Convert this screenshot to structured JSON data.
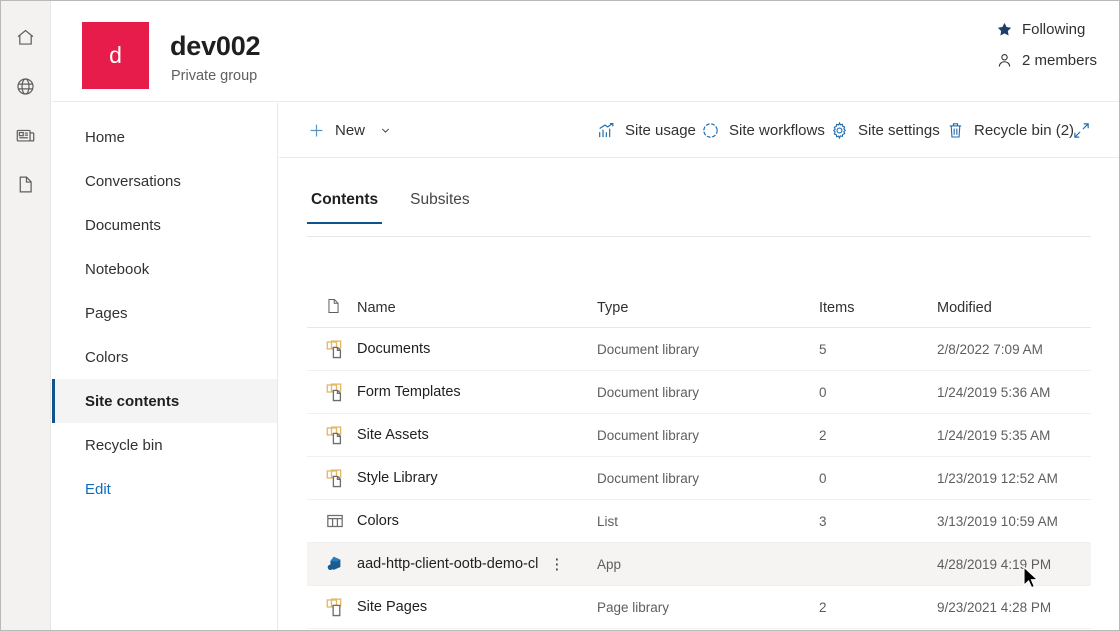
{
  "rail": {
    "items": [
      {
        "name": "home-icon",
        "label": "Home"
      },
      {
        "name": "globe-icon",
        "label": "My sites"
      },
      {
        "name": "news-icon",
        "label": "News"
      },
      {
        "name": "page-icon",
        "label": "Pages"
      }
    ]
  },
  "header": {
    "logo_letter": "d",
    "logo_color": "#e81c4a",
    "title": "dev002",
    "subtitle": "Private group",
    "following_label": "Following",
    "following_icon": "star-filled-icon",
    "members_label": "2 members",
    "members_icon": "person-icon"
  },
  "leftnav": {
    "items": [
      {
        "label": "Home",
        "selected": false,
        "link": false
      },
      {
        "label": "Conversations",
        "selected": false,
        "link": false
      },
      {
        "label": "Documents",
        "selected": false,
        "link": false
      },
      {
        "label": "Notebook",
        "selected": false,
        "link": false
      },
      {
        "label": "Pages",
        "selected": false,
        "link": false
      },
      {
        "label": "Colors",
        "selected": false,
        "link": false
      },
      {
        "label": "Site contents",
        "selected": true,
        "link": false
      },
      {
        "label": "Recycle bin",
        "selected": false,
        "link": false
      },
      {
        "label": "Edit",
        "selected": false,
        "link": true
      }
    ]
  },
  "commandbar": {
    "new_label": "New",
    "new_icon": "plus-icon",
    "chevron_icon": "chevron-down-icon",
    "site_usage_label": "Site usage",
    "site_usage_icon": "chart-trend-icon",
    "site_workflows_label": "Site workflows",
    "site_workflows_icon": "circular-arrow-icon",
    "site_settings_label": "Site settings",
    "site_settings_icon": "gear-icon",
    "recycle_bin_label": "Recycle bin (2)",
    "recycle_bin_icon": "trash-icon",
    "expand_icon": "diagonal-arrows-icon"
  },
  "tabs": [
    {
      "label": "Contents",
      "active": true
    },
    {
      "label": "Subsites",
      "active": false
    }
  ],
  "table": {
    "columns": {
      "icon": "file-type-icon",
      "name": "Name",
      "type": "Type",
      "items": "Items",
      "modified": "Modified"
    },
    "rows": [
      {
        "icon": "document-library-icon",
        "name": "Documents",
        "type": "Document library",
        "items": "5",
        "modified": "2/8/2022 7:09 AM",
        "hovered": false,
        "kebab": false
      },
      {
        "icon": "document-library-icon",
        "name": "Form Templates",
        "type": "Document library",
        "items": "0",
        "modified": "1/24/2019 5:36 AM",
        "hovered": false,
        "kebab": false
      },
      {
        "icon": "document-library-icon",
        "name": "Site Assets",
        "type": "Document library",
        "items": "2",
        "modified": "1/24/2019 5:35 AM",
        "hovered": false,
        "kebab": false
      },
      {
        "icon": "document-library-icon",
        "name": "Style Library",
        "type": "Document library",
        "items": "0",
        "modified": "1/23/2019 12:52 AM",
        "hovered": false,
        "kebab": false
      },
      {
        "icon": "list-icon",
        "name": "Colors",
        "type": "List",
        "items": "3",
        "modified": "3/13/2019 10:59 AM",
        "hovered": false,
        "kebab": false
      },
      {
        "icon": "app-package-icon",
        "name": "aad-http-client-ootb-demo-cl",
        "type": "App",
        "items": "",
        "modified": "4/28/2019 4:19 PM",
        "hovered": true,
        "kebab": true
      },
      {
        "icon": "page-library-icon",
        "name": "Site Pages",
        "type": "Page library",
        "items": "2",
        "modified": "9/23/2021 4:28 PM",
        "hovered": false,
        "kebab": false
      }
    ],
    "kebab_glyph": "⋮"
  }
}
